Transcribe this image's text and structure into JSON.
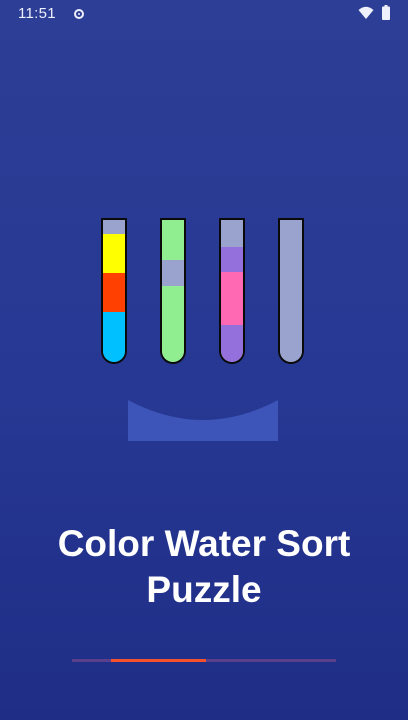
{
  "status_bar": {
    "time": "11:51",
    "icons": [
      "location-icon",
      "wifi-icon",
      "battery-icon"
    ]
  },
  "splash": {
    "title": "Color Water Sort Puzzle",
    "tubes": [
      {
        "layers": [
          "#9aa3cd",
          "#ffff00",
          "#ff4000",
          "#00c0ff"
        ]
      },
      {
        "layers": [
          "#90ee90",
          "#9aa3cd",
          "#90ee90"
        ]
      },
      {
        "layers": [
          "#9aa3cd",
          "#9370db",
          "#ff69b4",
          "#9370db"
        ]
      },
      {
        "layers": [
          "#9aa3cd"
        ]
      }
    ]
  },
  "loading": {
    "progress": 0.36,
    "colors": {
      "track": "#5a3f8a",
      "fill": "#f4512c"
    }
  },
  "colors": {
    "background": "#2a3a94",
    "stand": "#3d55b8"
  }
}
